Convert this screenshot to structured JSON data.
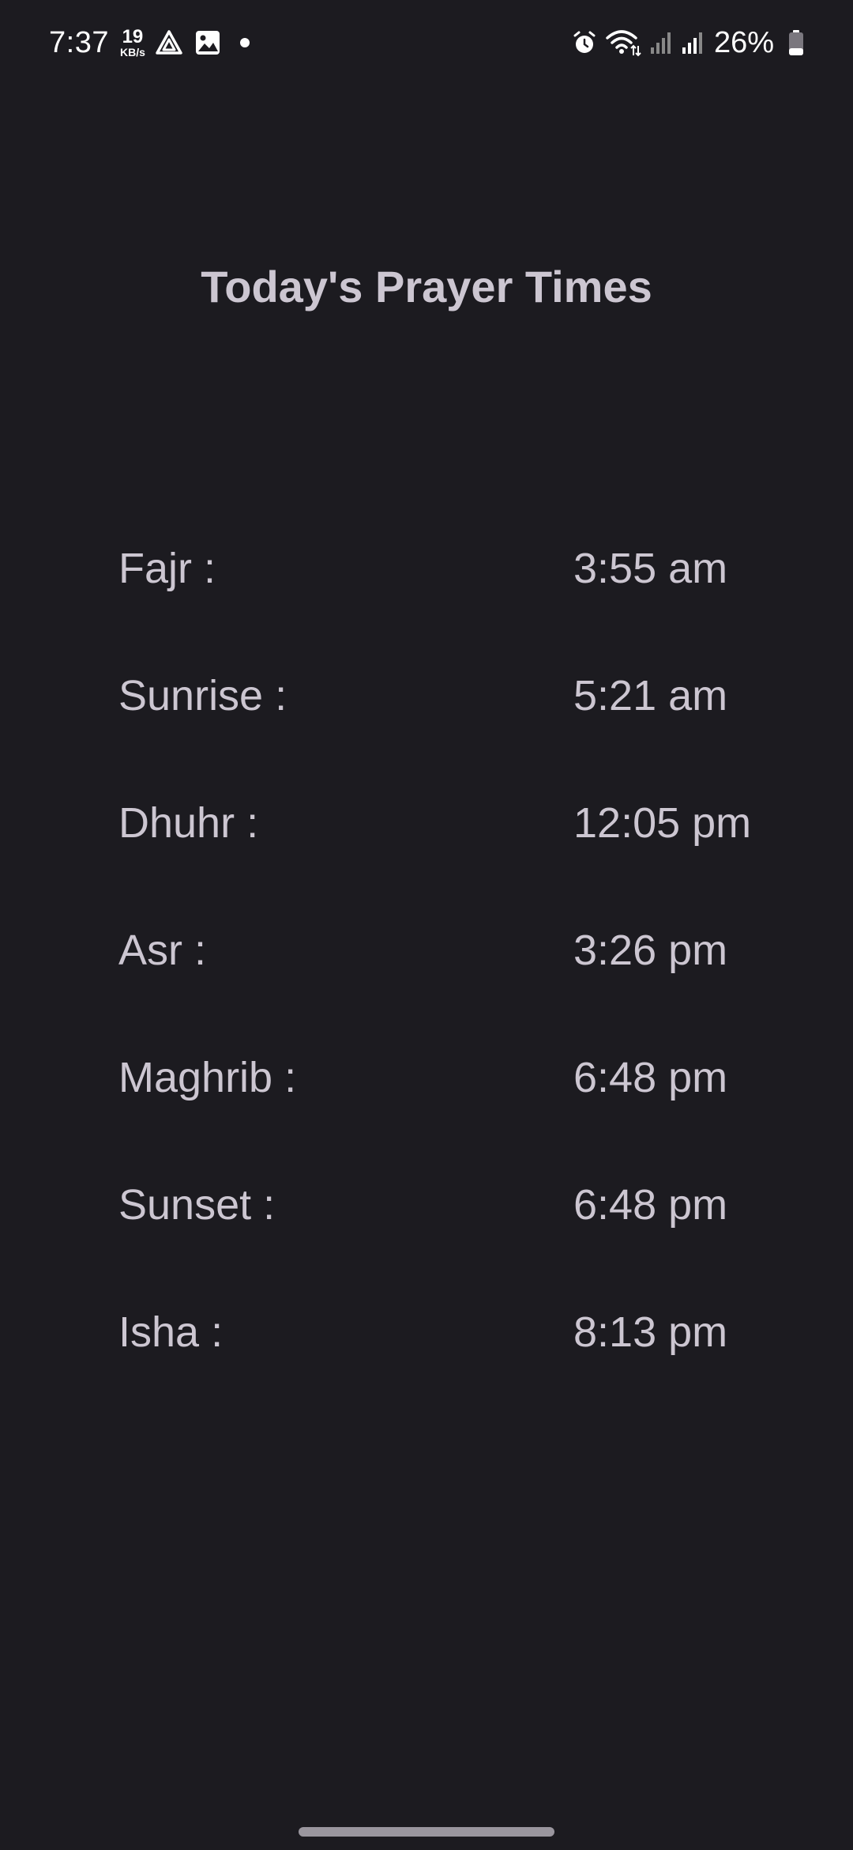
{
  "status_bar": {
    "time": "7:37",
    "net_speed_value": "19",
    "net_speed_unit": "KB/s",
    "battery_percent": "26%",
    "icons": [
      "drive-icon",
      "image-icon",
      "notification-dot",
      "alarm-icon",
      "wifi-icon",
      "signal-icon",
      "signal-icon",
      "battery-icon"
    ]
  },
  "screen": {
    "title": "Today's Prayer Times"
  },
  "prayers": [
    {
      "name": "Fajr :",
      "time": "3:55 am"
    },
    {
      "name": "Sunrise :",
      "time": "5:21 am"
    },
    {
      "name": "Dhuhr :",
      "time": "12:05 pm"
    },
    {
      "name": "Asr :",
      "time": "3:26 pm"
    },
    {
      "name": "Maghrib :",
      "time": "6:48 pm"
    },
    {
      "name": "Sunset :",
      "time": "6:48 pm"
    },
    {
      "name": "Isha :",
      "time": "8:13 pm"
    }
  ],
  "colors": {
    "background": "#1c1b20",
    "text": "#ccc6d1",
    "status_text": "#ffffff"
  }
}
